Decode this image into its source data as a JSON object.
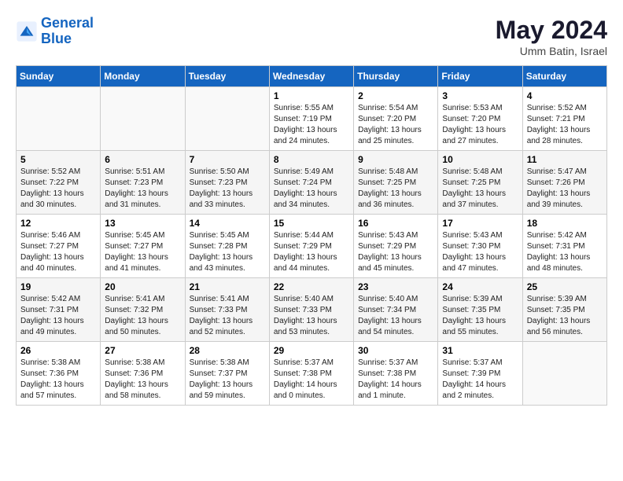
{
  "header": {
    "logo_line1": "General",
    "logo_line2": "Blue",
    "month_year": "May 2024",
    "location": "Umm Batin, Israel"
  },
  "weekdays": [
    "Sunday",
    "Monday",
    "Tuesday",
    "Wednesday",
    "Thursday",
    "Friday",
    "Saturday"
  ],
  "weeks": [
    [
      {
        "day": "",
        "info": ""
      },
      {
        "day": "",
        "info": ""
      },
      {
        "day": "",
        "info": ""
      },
      {
        "day": "1",
        "info": "Sunrise: 5:55 AM\nSunset: 7:19 PM\nDaylight: 13 hours\nand 24 minutes."
      },
      {
        "day": "2",
        "info": "Sunrise: 5:54 AM\nSunset: 7:20 PM\nDaylight: 13 hours\nand 25 minutes."
      },
      {
        "day": "3",
        "info": "Sunrise: 5:53 AM\nSunset: 7:20 PM\nDaylight: 13 hours\nand 27 minutes."
      },
      {
        "day": "4",
        "info": "Sunrise: 5:52 AM\nSunset: 7:21 PM\nDaylight: 13 hours\nand 28 minutes."
      }
    ],
    [
      {
        "day": "5",
        "info": "Sunrise: 5:52 AM\nSunset: 7:22 PM\nDaylight: 13 hours\nand 30 minutes."
      },
      {
        "day": "6",
        "info": "Sunrise: 5:51 AM\nSunset: 7:23 PM\nDaylight: 13 hours\nand 31 minutes."
      },
      {
        "day": "7",
        "info": "Sunrise: 5:50 AM\nSunset: 7:23 PM\nDaylight: 13 hours\nand 33 minutes."
      },
      {
        "day": "8",
        "info": "Sunrise: 5:49 AM\nSunset: 7:24 PM\nDaylight: 13 hours\nand 34 minutes."
      },
      {
        "day": "9",
        "info": "Sunrise: 5:48 AM\nSunset: 7:25 PM\nDaylight: 13 hours\nand 36 minutes."
      },
      {
        "day": "10",
        "info": "Sunrise: 5:48 AM\nSunset: 7:25 PM\nDaylight: 13 hours\nand 37 minutes."
      },
      {
        "day": "11",
        "info": "Sunrise: 5:47 AM\nSunset: 7:26 PM\nDaylight: 13 hours\nand 39 minutes."
      }
    ],
    [
      {
        "day": "12",
        "info": "Sunrise: 5:46 AM\nSunset: 7:27 PM\nDaylight: 13 hours\nand 40 minutes."
      },
      {
        "day": "13",
        "info": "Sunrise: 5:45 AM\nSunset: 7:27 PM\nDaylight: 13 hours\nand 41 minutes."
      },
      {
        "day": "14",
        "info": "Sunrise: 5:45 AM\nSunset: 7:28 PM\nDaylight: 13 hours\nand 43 minutes."
      },
      {
        "day": "15",
        "info": "Sunrise: 5:44 AM\nSunset: 7:29 PM\nDaylight: 13 hours\nand 44 minutes."
      },
      {
        "day": "16",
        "info": "Sunrise: 5:43 AM\nSunset: 7:29 PM\nDaylight: 13 hours\nand 45 minutes."
      },
      {
        "day": "17",
        "info": "Sunrise: 5:43 AM\nSunset: 7:30 PM\nDaylight: 13 hours\nand 47 minutes."
      },
      {
        "day": "18",
        "info": "Sunrise: 5:42 AM\nSunset: 7:31 PM\nDaylight: 13 hours\nand 48 minutes."
      }
    ],
    [
      {
        "day": "19",
        "info": "Sunrise: 5:42 AM\nSunset: 7:31 PM\nDaylight: 13 hours\nand 49 minutes."
      },
      {
        "day": "20",
        "info": "Sunrise: 5:41 AM\nSunset: 7:32 PM\nDaylight: 13 hours\nand 50 minutes."
      },
      {
        "day": "21",
        "info": "Sunrise: 5:41 AM\nSunset: 7:33 PM\nDaylight: 13 hours\nand 52 minutes."
      },
      {
        "day": "22",
        "info": "Sunrise: 5:40 AM\nSunset: 7:33 PM\nDaylight: 13 hours\nand 53 minutes."
      },
      {
        "day": "23",
        "info": "Sunrise: 5:40 AM\nSunset: 7:34 PM\nDaylight: 13 hours\nand 54 minutes."
      },
      {
        "day": "24",
        "info": "Sunrise: 5:39 AM\nSunset: 7:35 PM\nDaylight: 13 hours\nand 55 minutes."
      },
      {
        "day": "25",
        "info": "Sunrise: 5:39 AM\nSunset: 7:35 PM\nDaylight: 13 hours\nand 56 minutes."
      }
    ],
    [
      {
        "day": "26",
        "info": "Sunrise: 5:38 AM\nSunset: 7:36 PM\nDaylight: 13 hours\nand 57 minutes."
      },
      {
        "day": "27",
        "info": "Sunrise: 5:38 AM\nSunset: 7:36 PM\nDaylight: 13 hours\nand 58 minutes."
      },
      {
        "day": "28",
        "info": "Sunrise: 5:38 AM\nSunset: 7:37 PM\nDaylight: 13 hours\nand 59 minutes."
      },
      {
        "day": "29",
        "info": "Sunrise: 5:37 AM\nSunset: 7:38 PM\nDaylight: 14 hours\nand 0 minutes."
      },
      {
        "day": "30",
        "info": "Sunrise: 5:37 AM\nSunset: 7:38 PM\nDaylight: 14 hours\nand 1 minute."
      },
      {
        "day": "31",
        "info": "Sunrise: 5:37 AM\nSunset: 7:39 PM\nDaylight: 14 hours\nand 2 minutes."
      },
      {
        "day": "",
        "info": ""
      }
    ]
  ]
}
